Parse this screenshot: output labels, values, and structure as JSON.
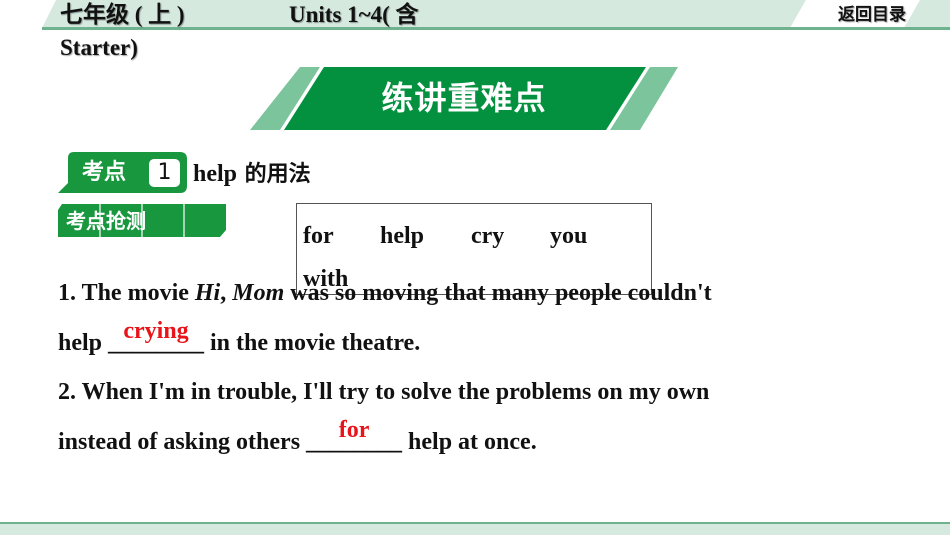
{
  "header": {
    "grade": "七年级 ( 上 )",
    "units": "Units 1~4( 含",
    "units_cont": "Starter)",
    "back_label": "返回目录",
    "colors": {
      "band": "#d5e9df",
      "line": "#6fb28f"
    }
  },
  "banner": {
    "title": "练讲重难点",
    "colors": {
      "main": "#03913f",
      "accent": "#7cc59c"
    }
  },
  "section": {
    "tag_label": "考点",
    "number": "1",
    "topic_en": "help",
    "topic_cn": " 的用法",
    "practice_tag": "考点抢测"
  },
  "word_bank": [
    "for",
    "help",
    "cry",
    "you",
    "with"
  ],
  "questions": [
    {
      "line1_prefix": "1. The movie ",
      "italic1": "Hi",
      "sep": ", ",
      "italic2": "Mom",
      "line1_suffix": " was so moving that many people couldn't",
      "line2_prefix": "help ",
      "blank": "________",
      "answer": "crying",
      "line2_suffix": " in the movie theatre."
    },
    {
      "line1": "2. When I'm in trouble, I'll try to solve the problems on my own",
      "line2_prefix": "instead of asking others ",
      "blank": "________",
      "answer": "for",
      "line2_suffix": " help at once."
    }
  ]
}
